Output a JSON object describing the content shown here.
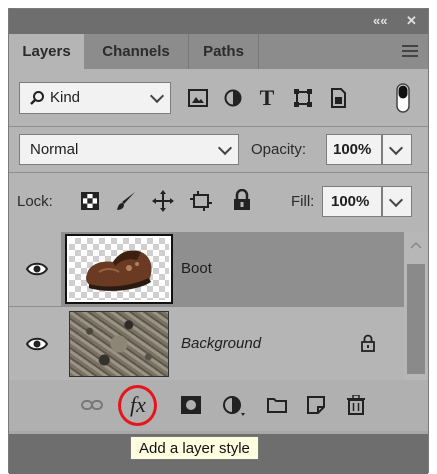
{
  "tabs": [
    {
      "label": "Layers",
      "active": true
    },
    {
      "label": "Channels",
      "active": false
    },
    {
      "label": "Paths",
      "active": false
    }
  ],
  "window_controls": {
    "collapse": "««",
    "close": "✕"
  },
  "filter": {
    "kind_label": "Kind",
    "icons": [
      "image-filter-icon",
      "adjustment-filter-icon",
      "type-filter-icon",
      "shape-filter-icon",
      "smart-object-filter-icon",
      "filter-toggle-icon"
    ]
  },
  "blend": {
    "mode": "Normal",
    "opacity_label": "Opacity:",
    "opacity_value": "100%"
  },
  "lock": {
    "label": "Lock:",
    "fill_label": "Fill:",
    "fill_value": "100%"
  },
  "layers": [
    {
      "name": "Boot",
      "visible": true,
      "selected": true,
      "italic": false,
      "locked": false
    },
    {
      "name": "Background",
      "visible": true,
      "selected": false,
      "italic": true,
      "locked": true
    }
  ],
  "bottom_icons": [
    "link-layers-icon",
    "add-layer-style-icon",
    "add-mask-icon",
    "adjustment-layer-icon",
    "new-group-icon",
    "new-layer-icon",
    "delete-layer-icon"
  ],
  "fx_label": "fx",
  "tooltip": "Add a layer style",
  "highlight_color": "#e8141c"
}
